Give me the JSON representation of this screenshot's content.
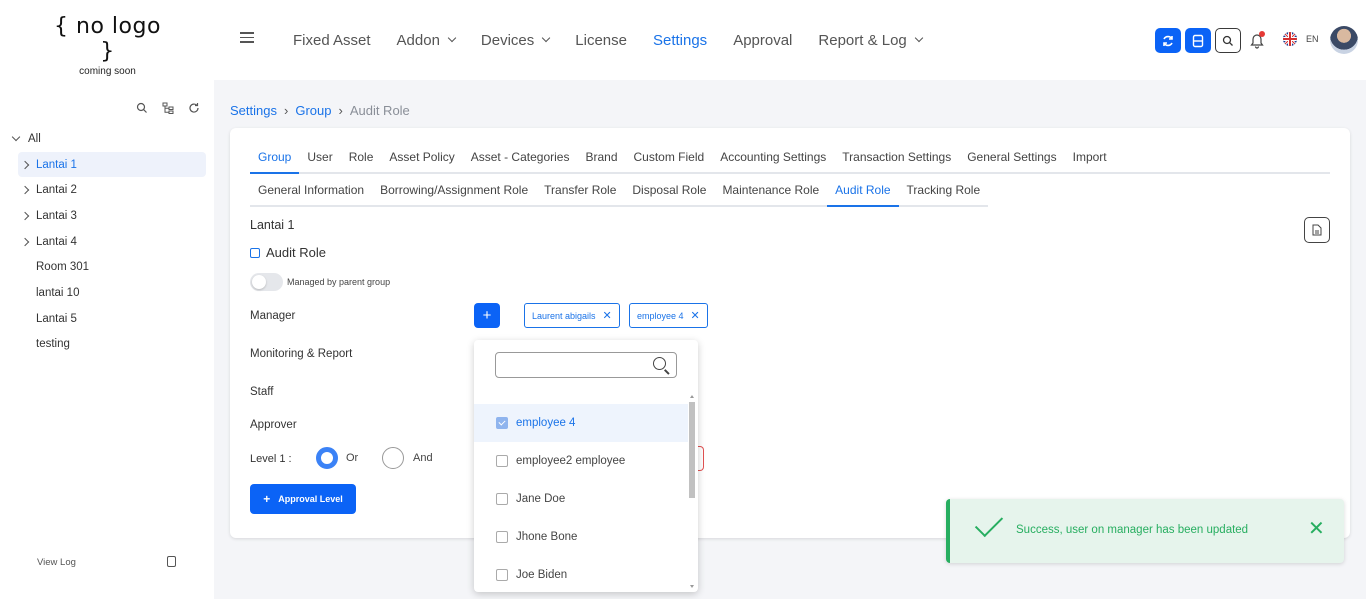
{
  "logo": {
    "line1": "{ no logo }",
    "line2": "coming soon"
  },
  "nav": {
    "items": [
      {
        "label": "Fixed Asset",
        "dropdown": false
      },
      {
        "label": "Addon",
        "dropdown": true
      },
      {
        "label": "Devices",
        "dropdown": true
      },
      {
        "label": "License",
        "dropdown": false
      },
      {
        "label": "Settings",
        "dropdown": false,
        "active": true
      },
      {
        "label": "Approval",
        "dropdown": false
      },
      {
        "label": "Report & Log",
        "dropdown": true
      }
    ],
    "language": "EN"
  },
  "sidebar": {
    "root": "All",
    "items": [
      {
        "label": "Lantai 1",
        "expandable": true,
        "active": true
      },
      {
        "label": "Lantai 2",
        "expandable": true
      },
      {
        "label": "Lantai 3",
        "expandable": true
      },
      {
        "label": "Lantai 4",
        "expandable": true
      },
      {
        "label": "Room 301",
        "expandable": false
      },
      {
        "label": "lantai 10",
        "expandable": false
      },
      {
        "label": "Lantai 5",
        "expandable": false
      },
      {
        "label": "testing",
        "expandable": false
      }
    ],
    "view_log": "View Log"
  },
  "breadcrumb": [
    "Settings",
    "Group",
    "Audit Role"
  ],
  "tabs_primary": [
    "Group",
    "User",
    "Role",
    "Asset Policy",
    "Asset - Categories",
    "Brand",
    "Custom Field",
    "Accounting Settings",
    "Transaction Settings",
    "General Settings",
    "Import"
  ],
  "tabs_secondary": [
    "General Information",
    "Borrowing/Assignment Role",
    "Transfer Role",
    "Disposal Role",
    "Maintenance Role",
    "Audit Role",
    "Tracking Role"
  ],
  "content": {
    "group_name": "Lantai 1",
    "section_title": "Audit Role",
    "toggle_label": "Managed by parent group",
    "fields": {
      "manager": "Manager",
      "monitoring": "Monitoring & Report",
      "staff": "Staff",
      "approver": "Approver",
      "level": "Level 1 :"
    },
    "add_symbol": "+",
    "chips": [
      "Laurent abigails",
      "employee 4"
    ],
    "radio_or": "Or",
    "radio_and": "And",
    "approval_level_button": "Approval Level"
  },
  "dropdown": {
    "search_placeholder": "",
    "options": [
      {
        "label": "employee 4",
        "checked": true
      },
      {
        "label": "employee2 employee",
        "checked": false
      },
      {
        "label": "Jane Doe",
        "checked": false
      },
      {
        "label": "Jhone Bone",
        "checked": false
      },
      {
        "label": "Joe Biden",
        "checked": false
      }
    ]
  },
  "toast": {
    "message": "Success, user on manager has been updated",
    "close": "✕"
  },
  "colors": {
    "primary": "#0b63f6",
    "link": "#1a73e8",
    "success": "#27ae60"
  }
}
